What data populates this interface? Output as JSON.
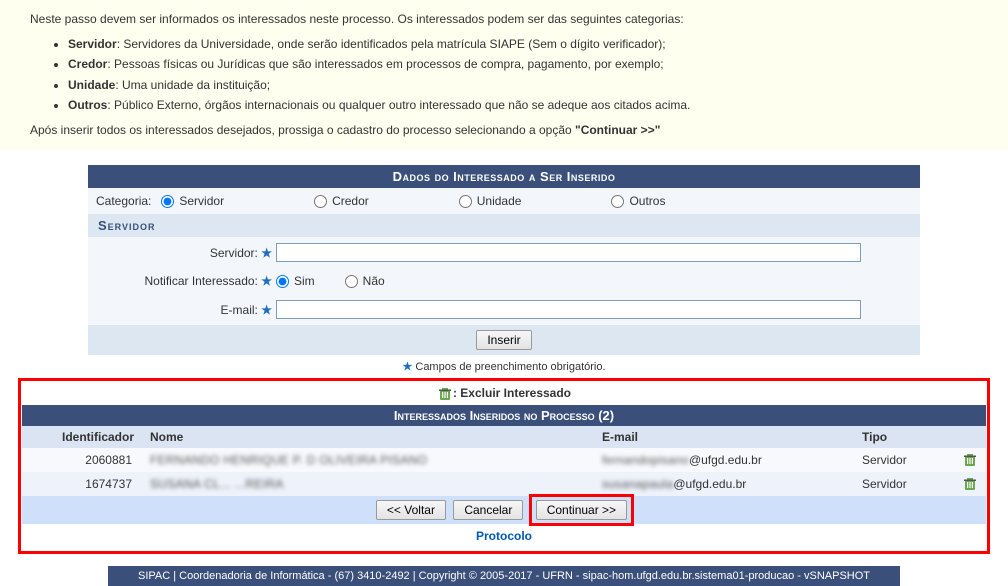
{
  "info": {
    "intro": "Neste passo devem ser informados os interessados neste processo. Os interessados podem ser das seguintes categorias:",
    "bullets": [
      {
        "term": "Servidor",
        "desc": ": Servidores da Universidade, onde serão identificados pela matrícula SIAPE (Sem o dígito verificador);"
      },
      {
        "term": "Credor",
        "desc": ": Pessoas físicas ou Jurídicas que são interessados em processos de compra, pagamento, por exemplo;"
      },
      {
        "term": "Unidade",
        "desc": ": Uma unidade da instituição;"
      },
      {
        "term": "Outros",
        "desc": ": Público Externo, órgãos internacionais ou qualquer outro interessado que não se adeque aos citados acima."
      }
    ],
    "after": "Após inserir todos os interessados desejados, prossiga o cadastro do processo selecionando a opção ",
    "continue_label": "\"Continuar >>\""
  },
  "form": {
    "title": "Dados do Interessado a Ser Inserido",
    "categoria_label": "Categoria:",
    "categorias": {
      "servidor": "Servidor",
      "credor": "Credor",
      "unidade": "Unidade",
      "outros": "Outros"
    },
    "servidor_header": "Servidor",
    "servidor_label": "Servidor:",
    "servidor_value": "",
    "notificar_label": "Notificar Interessado:",
    "notificar_opts": {
      "sim": "Sim",
      "nao": "Não"
    },
    "email_label": "E-mail:",
    "email_value": "",
    "inserir_btn": "Inserir",
    "mandatory_note": "Campos de preenchimento obrigatório."
  },
  "list": {
    "excluir_label": ": Excluir Interessado",
    "header": "Interessados Inseridos no Processo (2)",
    "cols": {
      "id": "Identificador",
      "nome": "Nome",
      "email": "E-mail",
      "tipo": "Tipo"
    },
    "rows": [
      {
        "id": "2060881",
        "nome": "FERNANDO HENRIQUE P. D OLIVEIRA PISANO",
        "email_masked": "fernandopisano",
        "email_suffix": "@ufgd.edu.br",
        "tipo": "Servidor"
      },
      {
        "id": "1674737",
        "nome": "SUSANA CL... ...REIRA",
        "email_masked": "susanapaula",
        "email_suffix": "@ufgd.edu.br",
        "tipo": "Servidor"
      }
    ]
  },
  "actions": {
    "voltar": "<< Voltar",
    "cancelar": "Cancelar",
    "continuar": "Continuar >>"
  },
  "protocolo": "Protocolo",
  "footer": "SIPAC | Coordenadoria de Informática - (67) 3410-2492 | Copyright © 2005-2017 - UFRN - sipac-hom.ufgd.edu.br.sistema01-producao - vSNAPSHOT"
}
